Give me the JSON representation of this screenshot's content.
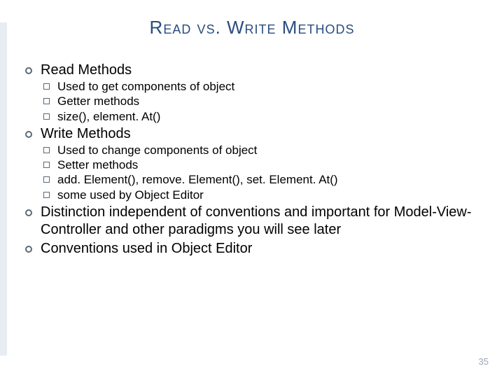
{
  "title": "Read vs. Write Methods",
  "bullets": {
    "read": {
      "heading": "Read Methods",
      "items": [
        "Used to get components of object",
        "Getter methods",
        "size(), element. At()"
      ]
    },
    "write": {
      "heading": "Write Methods",
      "items": [
        "Used to change components of object",
        "Setter methods",
        "add. Element(), remove. Element(), set. Element. At()",
        "some used by Object Editor"
      ]
    },
    "distinction": "Distinction independent of conventions and important for Model-View-Controller and other paradigms you will see later",
    "conventions": "Conventions used in Object Editor"
  },
  "page_number": "35"
}
